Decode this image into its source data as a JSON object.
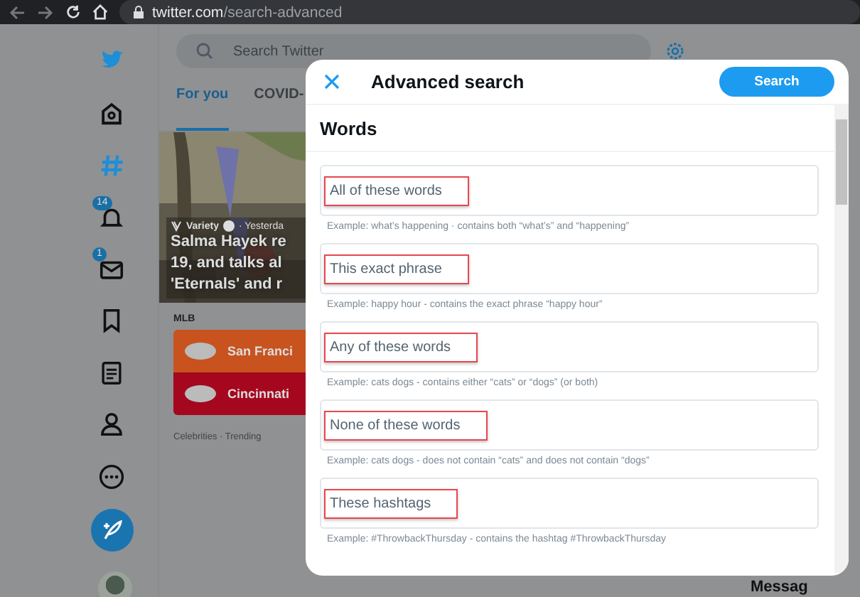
{
  "browser": {
    "url_host": "twitter.com",
    "url_path": "/search-advanced"
  },
  "nav": {
    "badges": [
      "14",
      "1"
    ]
  },
  "main": {
    "search_placeholder": "Search Twitter",
    "tabs": [
      {
        "label": "For you",
        "selected": true
      },
      {
        "label": "COVID-",
        "selected": false
      }
    ],
    "story": {
      "kind": "picture",
      "source": "Variety",
      "time": "· Yesterda",
      "headline_lines": [
        "Salma Hayek re",
        "19, and talks al",
        "'Eternals' and r"
      ]
    },
    "game": {
      "league": "MLB",
      "teams": [
        {
          "name": "San Franci",
          "color": "#c8531e"
        },
        {
          "name": "Cincinnati",
          "color": "#a5071f"
        }
      ]
    },
    "trend": "Celebrities · Trending"
  },
  "side": {
    "messages": "Messag"
  },
  "modal": {
    "title": "Advanced search",
    "action": "Search",
    "section": "Words",
    "fields": [
      {
        "placeholder": "All of these words",
        "highlighted": true,
        "example": "Example: what’s happening · contains both “what’s” and “happening”"
      },
      {
        "placeholder": "This exact phrase",
        "highlighted": true,
        "example": "Example: happy hour - contains the exact phrase “happy hour”"
      },
      {
        "placeholder": "Any of these words",
        "highlighted": true,
        "example": "Example: cats dogs - contains either “cats” or “dogs” (or both)"
      },
      {
        "placeholder": "None of these words",
        "highlighted": true,
        "example": "Example: cats dogs - does not contain “cats” and does not contain “dogs”"
      },
      {
        "placeholder": "These hashtags",
        "highlighted": true,
        "example": "Example: #ThrowbackThursday - contains the hashtag #ThrowbackThursday"
      }
    ]
  }
}
